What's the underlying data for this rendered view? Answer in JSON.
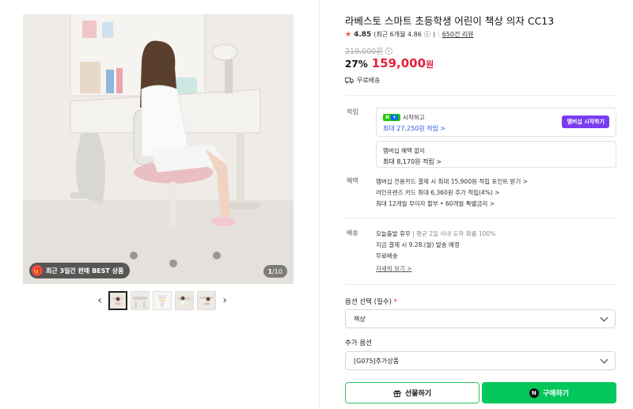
{
  "gallery": {
    "best_badge": "최근 3일간 판매 BEST 상품",
    "page_current": "1",
    "page_total": "/10",
    "prev_icon": "‹",
    "next_icon": "›",
    "thumbnail_count": 5
  },
  "product": {
    "title": "라베스토 스마트 초등학생 어린이 책상 의자 CC13",
    "rating_score": "4.85",
    "rating_recent": "(최근 6개월 4.86",
    "rating_info_icon": "ⓘ",
    "rating_close": ")",
    "review_count": "650건 리뷰",
    "original_price": "219,000원",
    "discount_rate": "27%",
    "sale_price": "159,000",
    "sale_price_unit": "원",
    "shipping": "무료배송"
  },
  "points": {
    "label": "적립",
    "box1_line1": "시작하고",
    "box1_line2": "최대 27,250원 적립 >",
    "member_button": "멤버십 시작하기",
    "box2_line1": "멤버십 혜택 없이",
    "box2_line2": "최대 8,170원 적립 >"
  },
  "benefits": {
    "label": "혜택",
    "items": [
      "멤버십 전용카드 결제 시 최대 15,900원 적립 포인트 받기 >",
      "라인프렌즈 카드 최대 6,360원 추가 적립(4%) >",
      "최대 12개월 무이자 할부 • 60개월 특별금리 >"
    ]
  },
  "delivery": {
    "label": "배송",
    "line1_a": "오늘출발 휴무",
    "line1_b": " | 평균 2일 이내 도착 확률 100%",
    "line2": "지금 결제 시 9.28.(월) 발송 예정",
    "line3": "무료배송",
    "detail_link": "자세히 보기 >"
  },
  "options": {
    "option_label": "옵션 선택 (필수)",
    "required_mark": "*",
    "option_value": "책상",
    "extra_label": "추가 옵션",
    "extra_value": "[G075]추가상품"
  },
  "actions": {
    "gift_label": "선물하기",
    "buy_label": "구매하기",
    "n_icon_text": "N"
  },
  "colors": {
    "sale_red": "#e8203d",
    "naver_green": "#03c75a",
    "membership_purple": "#7a3cf0",
    "point_blue": "#2b57e8"
  }
}
